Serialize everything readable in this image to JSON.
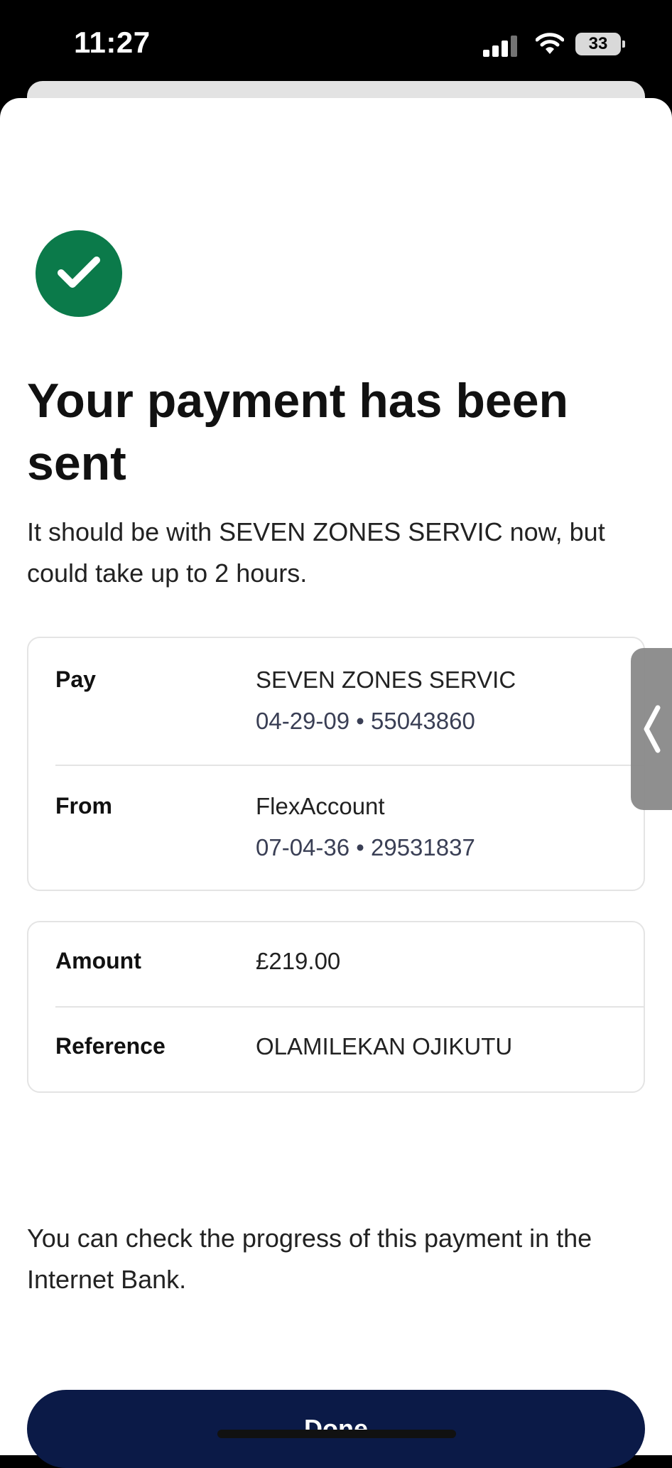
{
  "status_bar": {
    "time": "11:27",
    "battery": "33",
    "icons": [
      "signal-icon",
      "wifi-icon",
      "battery-icon"
    ]
  },
  "confirmation": {
    "icon": "check-circle-icon",
    "icon_color": "#0b7a4a",
    "title": "Your payment has been sent",
    "subtitle": "It should be with SEVEN ZONES SERVIC now, but could take up to 2 hours."
  },
  "payment_details": {
    "pay_label": "Pay",
    "pay_name": "SEVEN ZONES SERVIC",
    "pay_account": "04-29-09 • 55043860",
    "from_label": "From",
    "from_name": "FlexAccount",
    "from_account": "07-04-36 • 29531837"
  },
  "amount_details": {
    "amount_label": "Amount",
    "amount_value": "£219.00",
    "reference_label": "Reference",
    "reference_value": "OLAMILEKAN OJIKUTU"
  },
  "footer": {
    "note": "You can check the progress of this payment in the Internet Bank."
  },
  "actions": {
    "done_label": "Done",
    "done_color": "#0b1a47"
  }
}
